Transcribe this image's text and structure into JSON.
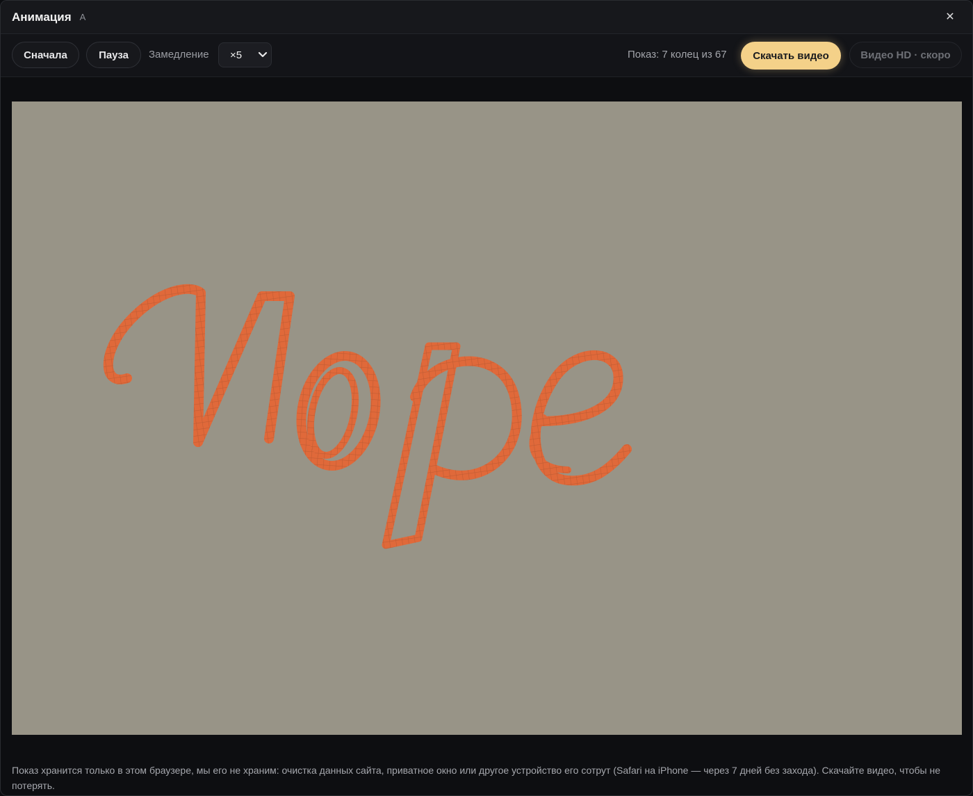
{
  "window": {
    "title": "Анимация",
    "title_badge": "A",
    "close_icon": "close-icon"
  },
  "toolbar": {
    "restart_label": "Сначала",
    "pause_label": "Пауза",
    "slowdown_label": "Замедление",
    "slowdown_value": "×5",
    "status_text": "Показ: 7 колец из 67",
    "download_label": "Скачать видео",
    "hd_label": "Видео HD · скоро"
  },
  "stage": {
    "background_color": "#989487",
    "mosaic_color": "#e0693a",
    "word": "Nope"
  },
  "footer": {
    "note": "Показ хранится только в этом браузере, мы его не храним: очистка данных сайта, приватное окно или другое устройство его сотрут (Safari на iPhone — через 7 дней без захода). Скачайте видео, чтобы не потерять."
  },
  "colors": {
    "accent": "#f4d189",
    "window_bg": "#0d0e11"
  }
}
